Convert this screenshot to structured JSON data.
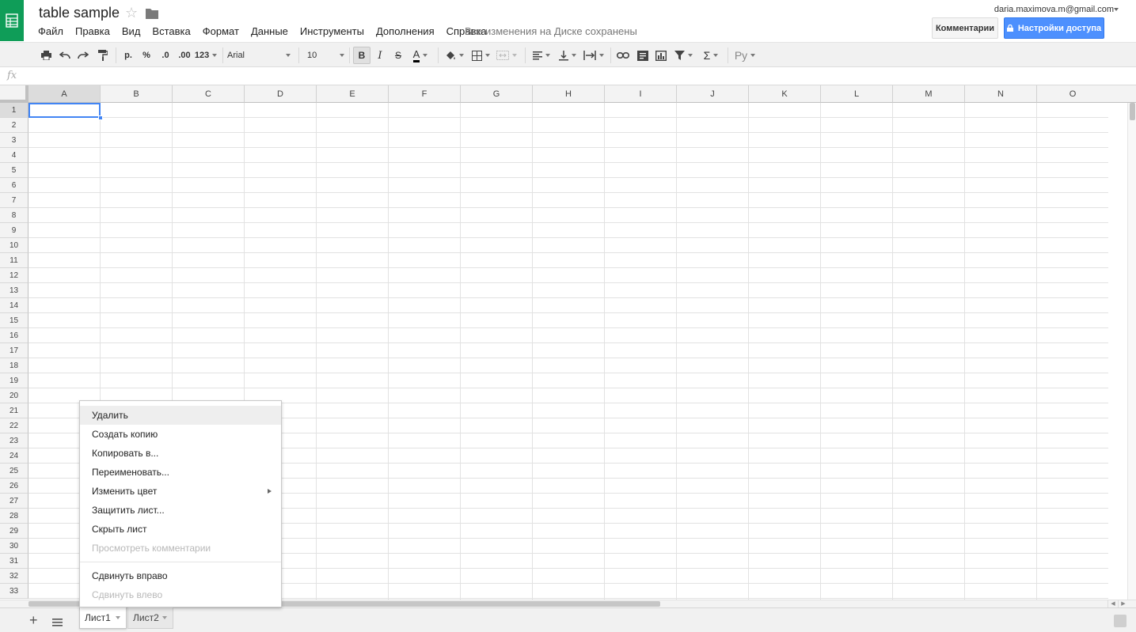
{
  "doc": {
    "title": "table sample",
    "saved_status": "Все изменения на Диске сохранены"
  },
  "menu": [
    "Файл",
    "Правка",
    "Вид",
    "Вставка",
    "Формат",
    "Данные",
    "Инструменты",
    "Дополнения",
    "Справка"
  ],
  "user": {
    "email": "daria.maximova.m@gmail.com"
  },
  "buttons": {
    "comments": "Комментарии",
    "share": "Настройки доступа"
  },
  "toolbar": {
    "currency": "р.",
    "percent": "%",
    "dec_less": ".0",
    "dec_more": ".00",
    "format_more": "123",
    "font": "Arial",
    "font_size": "10",
    "bold": "B",
    "italic": "I",
    "strike": "S",
    "text_color": "A",
    "sum": "Σ",
    "input_tools": "Ру"
  },
  "formula_bar": {
    "fx": "fx"
  },
  "grid": {
    "columns": [
      "A",
      "B",
      "C",
      "D",
      "E",
      "F",
      "G",
      "H",
      "I",
      "J",
      "K",
      "L",
      "M",
      "N",
      "O"
    ],
    "rows": [
      "1",
      "2",
      "3",
      "4",
      "5",
      "6",
      "7",
      "8",
      "9",
      "10",
      "11",
      "12",
      "13",
      "14",
      "15",
      "16",
      "17",
      "18",
      "19",
      "20",
      "21",
      "22",
      "23",
      "24",
      "25",
      "26",
      "27",
      "28",
      "29",
      "30",
      "31",
      "32",
      "33"
    ],
    "selected_cell": "A1"
  },
  "sheets": [
    {
      "name": "Лист1",
      "active": true
    },
    {
      "name": "Лист2",
      "active": false
    }
  ],
  "context_menu": {
    "items": [
      {
        "label": "Удалить",
        "state": "hover"
      },
      {
        "label": "Создать копию",
        "state": "normal"
      },
      {
        "label": "Копировать в...",
        "state": "normal"
      },
      {
        "label": "Переименовать...",
        "state": "normal"
      },
      {
        "label": "Изменить цвет",
        "state": "normal",
        "submenu": true
      },
      {
        "label": "Защитить лист...",
        "state": "normal"
      },
      {
        "label": "Скрыть лист",
        "state": "normal"
      },
      {
        "label": "Просмотреть комментарии",
        "state": "disabled"
      },
      {
        "separator": true
      },
      {
        "label": "Сдвинуть вправо",
        "state": "normal"
      },
      {
        "label": "Сдвинуть влево",
        "state": "disabled"
      }
    ]
  },
  "colors": {
    "brand_green": "#0f9d58",
    "share_blue": "#4d90fe",
    "selection_blue": "#4285f4"
  }
}
